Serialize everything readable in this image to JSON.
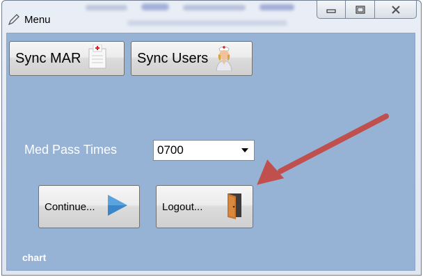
{
  "window": {
    "title": "Menu"
  },
  "toolbar": {
    "sync_mar_label": "Sync MAR",
    "sync_users_label": "Sync Users"
  },
  "med_pass": {
    "label": "Med Pass Times",
    "selected": "0700"
  },
  "actions": {
    "continue_label": "Continue...",
    "logout_label": "Logout..."
  },
  "footer": {
    "chart_label": "chart"
  },
  "icons": {
    "app": "pen-icon",
    "sync_mar": "document-cross-icon",
    "sync_users": "nurse-icon",
    "continue": "play-arrow-icon",
    "logout": "door-icon",
    "annotation": "red-arrow"
  },
  "colors": {
    "client_bg": "#96b2d4",
    "annotation_arrow": "#c0504d",
    "play_arrow": "#3a86c8"
  }
}
